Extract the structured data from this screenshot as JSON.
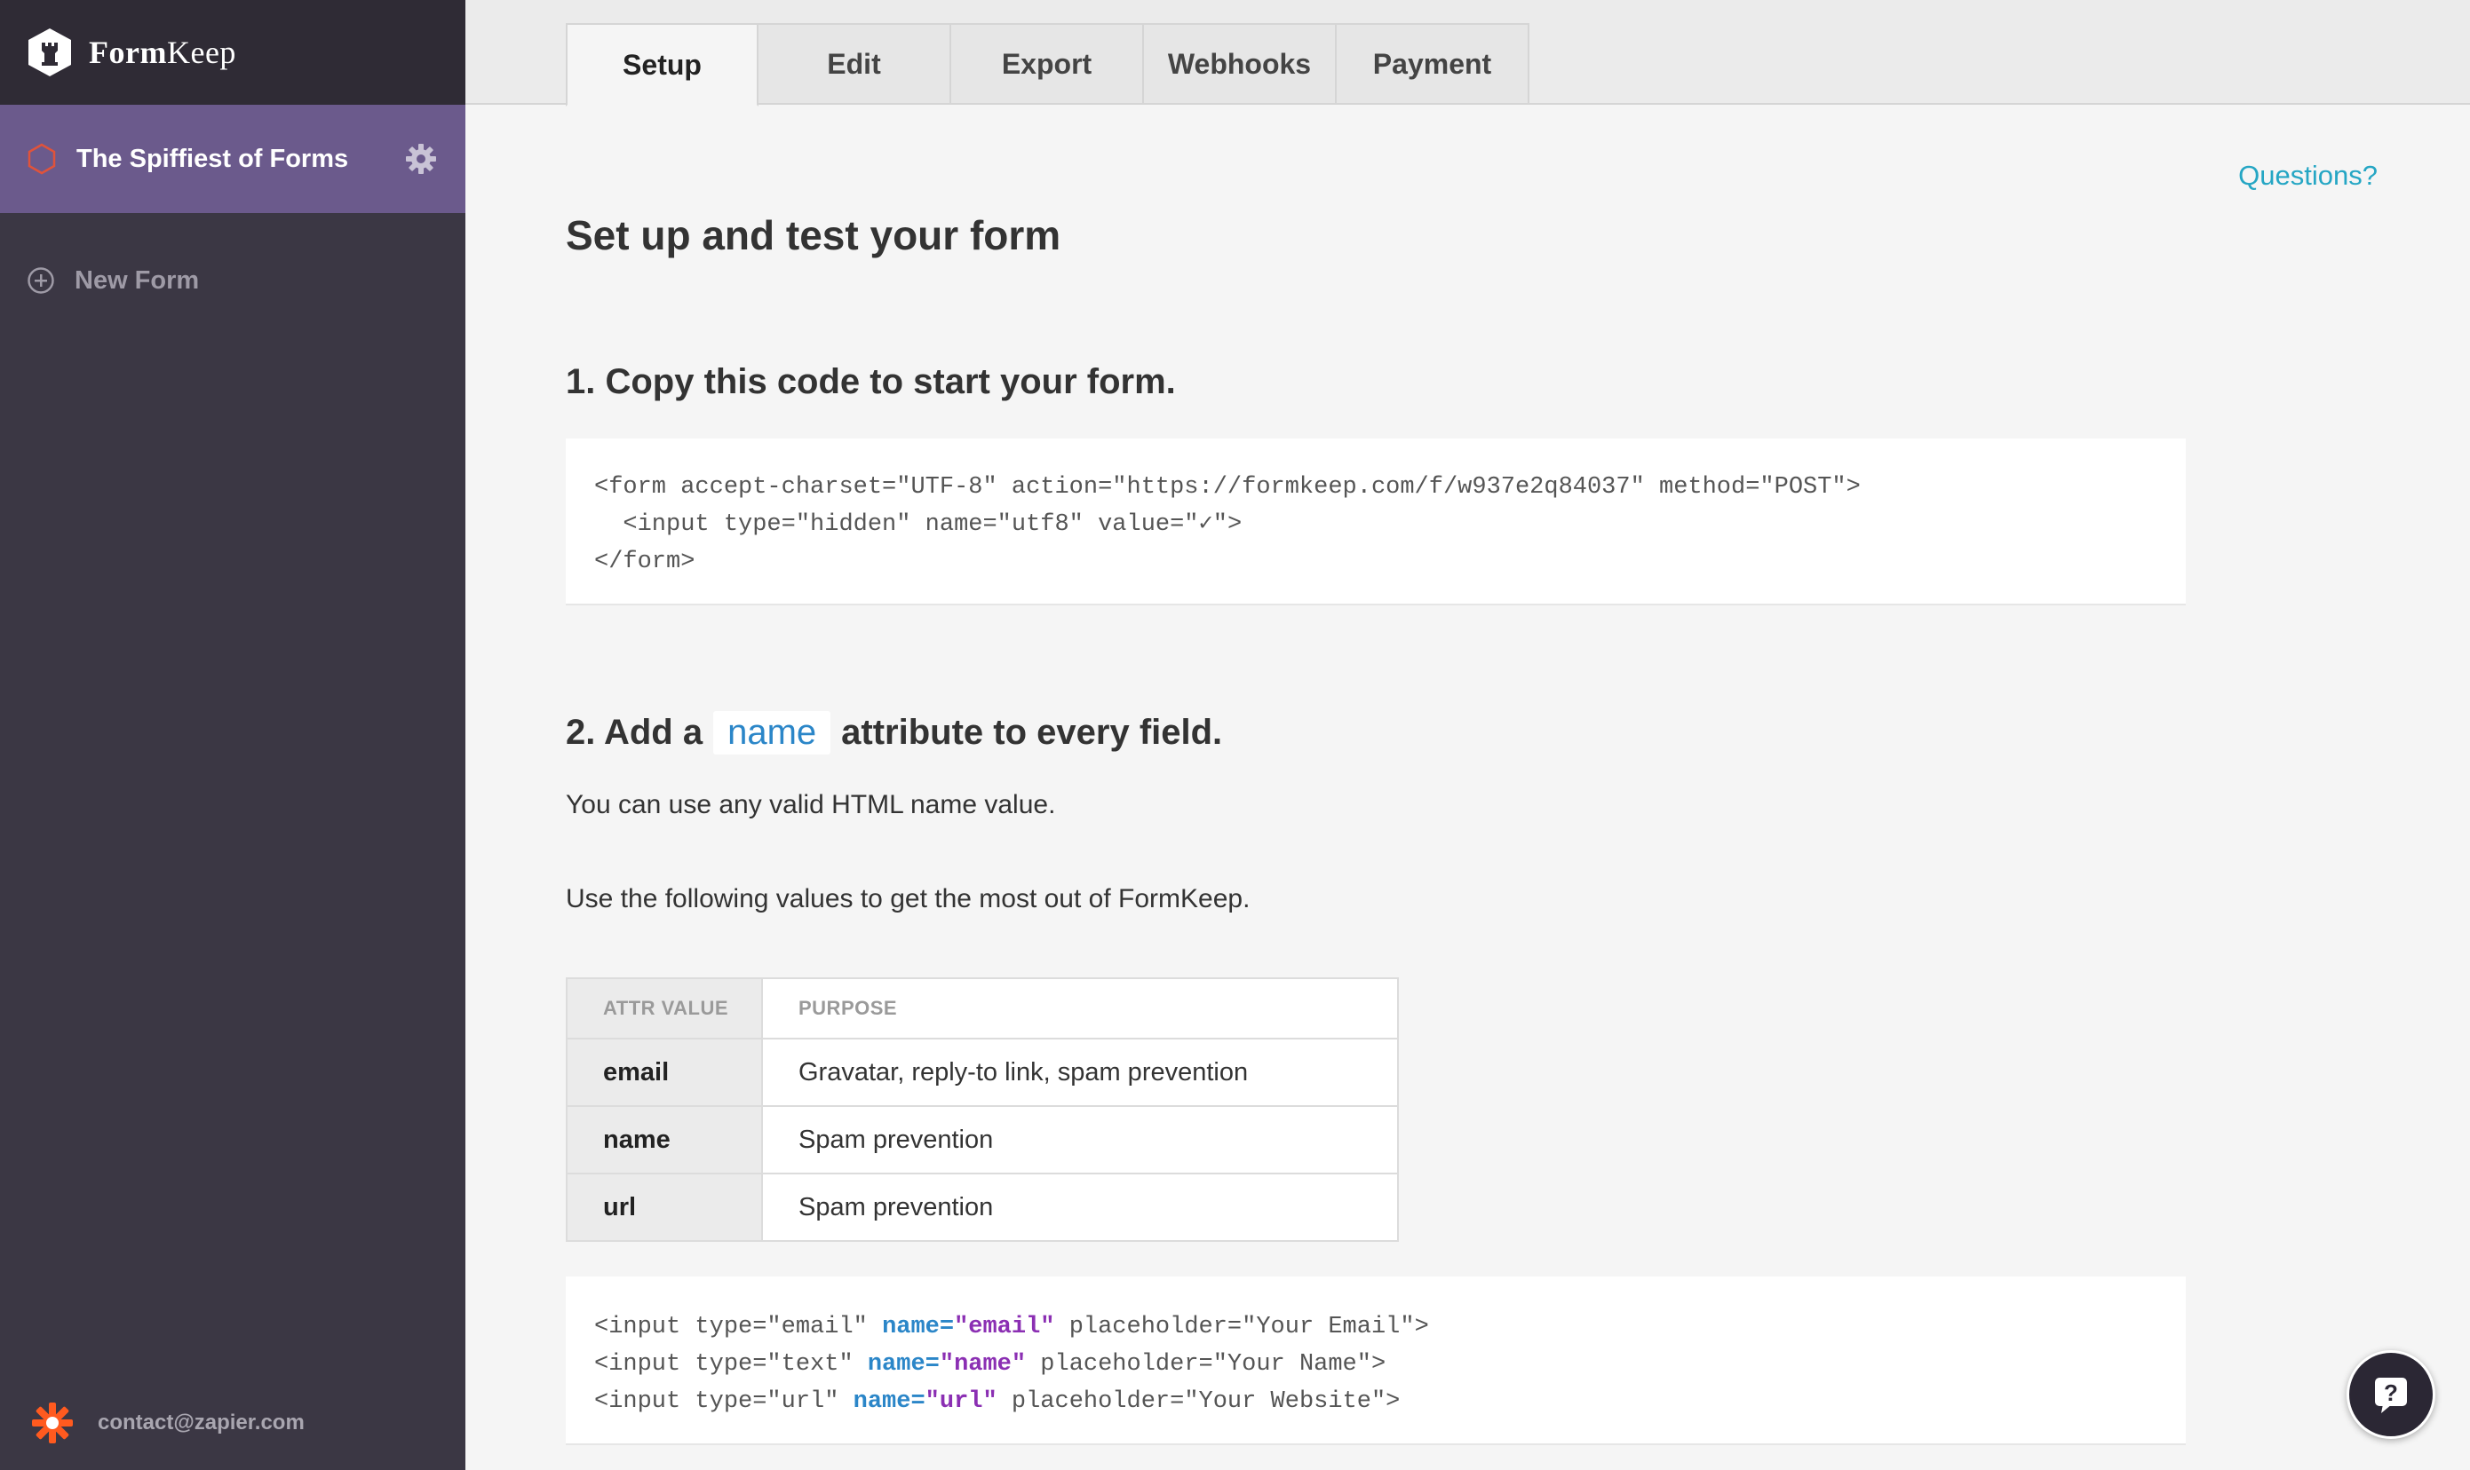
{
  "app": {
    "logo_bold": "Form",
    "logo_rest": "Keep"
  },
  "sidebar": {
    "current_form": "The Spiffiest of Forms",
    "new_form_label": "New Form",
    "user_email": "contact@zapier.com"
  },
  "tabs": [
    "Setup",
    "Edit",
    "Export",
    "Webhooks",
    "Payment"
  ],
  "active_tab": "Setup",
  "main": {
    "questions_link": "Questions?",
    "title": "Set up and test your form",
    "step1_title": "1. Copy this code to start your form.",
    "code1": [
      "<form accept-charset=\"UTF-8\" action=\"https://formkeep.com/f/w937e2q84037\" method=\"POST\">",
      "  <input type=\"hidden\" name=\"utf8\" value=\"✓\">",
      "</form>"
    ],
    "step2_prefix": "2. Add a",
    "step2_chip": "name",
    "step2_suffix": "attribute to every field.",
    "para1": "You can use any valid HTML name value.",
    "para2": "Use the following values to get the most out of FormKeep.",
    "table": {
      "headers": [
        "ATTR VALUE",
        "PURPOSE"
      ],
      "rows": [
        [
          "email",
          "Gravatar, reply-to link, spam prevention"
        ],
        [
          "name",
          "Spam prevention"
        ],
        [
          "url",
          "Spam prevention"
        ]
      ]
    },
    "code2": [
      {
        "pre": "<input type=\"email\" ",
        "attr": "name=",
        "val": "\"email\"",
        "post": " placeholder=\"Your Email\">"
      },
      {
        "pre": "<input type=\"text\" ",
        "attr": "name=",
        "val": "\"name\"",
        "post": " placeholder=\"Your Name\">"
      },
      {
        "pre": "<input type=\"url\" ",
        "attr": "name=",
        "val": "\"url\"",
        "post": " placeholder=\"Your Website\">"
      }
    ]
  },
  "colors": {
    "sidebar_bg": "#3b3744",
    "sidebar_active": "#6b5a8c",
    "accent": "#25a6c4",
    "code_attr": "#2b86c8",
    "code_val": "#8b2fb3"
  },
  "icons": [
    "formkeep-logo-icon",
    "hexagon-icon",
    "gear-icon",
    "plus-circle-icon",
    "zapier-icon",
    "help-icon"
  ]
}
